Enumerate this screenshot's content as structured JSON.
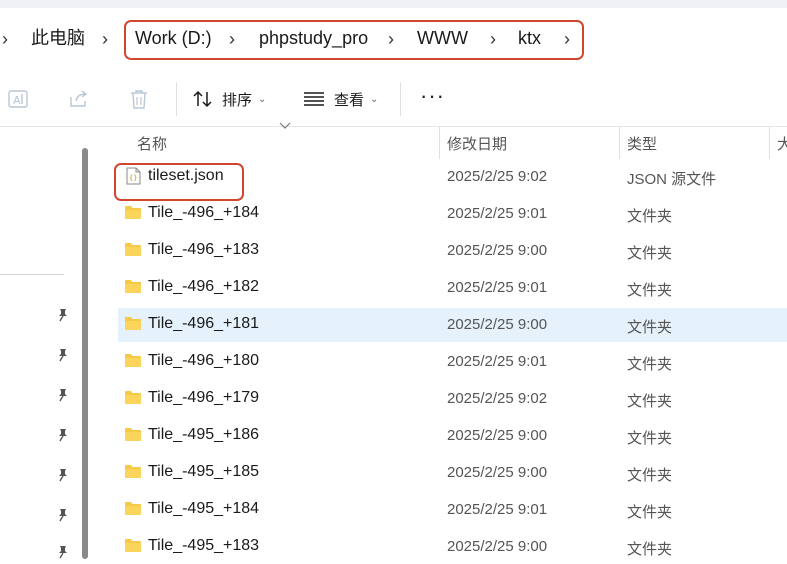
{
  "breadcrumb": {
    "items": [
      "此电脑",
      "Work (D:)",
      "phpstudy_pro",
      "WWW",
      "ktx"
    ],
    "separator": "›"
  },
  "toolbar": {
    "sort_label": "排序",
    "view_label": "查看",
    "more_label": "···",
    "icons": [
      "rename-icon",
      "share-icon",
      "delete-icon",
      "sort-icon",
      "view-icon",
      "more-icon"
    ]
  },
  "columns": {
    "name": "名称",
    "date": "修改日期",
    "type": "类型",
    "size": "大"
  },
  "files": [
    {
      "name": "tileset.json",
      "date": "2025/2/25 9:02",
      "type": "JSON 源文件",
      "kind": "json"
    },
    {
      "name": "Tile_-496_+184",
      "date": "2025/2/25 9:01",
      "type": "文件夹",
      "kind": "folder"
    },
    {
      "name": "Tile_-496_+183",
      "date": "2025/2/25 9:00",
      "type": "文件夹",
      "kind": "folder"
    },
    {
      "name": "Tile_-496_+182",
      "date": "2025/2/25 9:01",
      "type": "文件夹",
      "kind": "folder"
    },
    {
      "name": "Tile_-496_+181",
      "date": "2025/2/25 9:00",
      "type": "文件夹",
      "kind": "folder",
      "selected": true
    },
    {
      "name": "Tile_-496_+180",
      "date": "2025/2/25 9:01",
      "type": "文件夹",
      "kind": "folder"
    },
    {
      "name": "Tile_-496_+179",
      "date": "2025/2/25 9:02",
      "type": "文件夹",
      "kind": "folder"
    },
    {
      "name": "Tile_-495_+186",
      "date": "2025/2/25 9:00",
      "type": "文件夹",
      "kind": "folder"
    },
    {
      "name": "Tile_-495_+185",
      "date": "2025/2/25 9:00",
      "type": "文件夹",
      "kind": "folder"
    },
    {
      "name": "Tile_-495_+184",
      "date": "2025/2/25 9:01",
      "type": "文件夹",
      "kind": "folder"
    },
    {
      "name": "Tile_-495_+183",
      "date": "2025/2/25 9:00",
      "type": "文件夹",
      "kind": "folder"
    }
  ],
  "colors": {
    "highlight_border": "#d2452f",
    "selected_row": "#e5f1fb",
    "folder": "#f7c948"
  }
}
